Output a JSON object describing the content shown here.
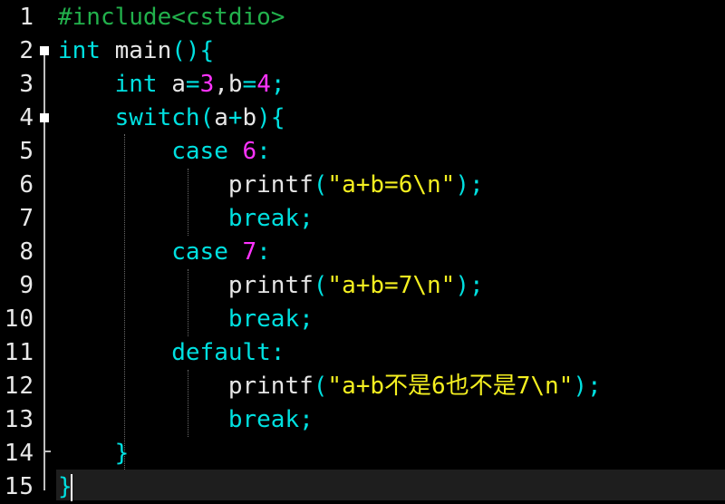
{
  "editor": {
    "colors": {
      "background": "#000000",
      "preprocessor": "#22b14c",
      "keyword": "#00e0e0",
      "identifier": "#e6e6e6",
      "number": "#ff33ff",
      "string": "#f5f020",
      "line_number": "#e8e8e8",
      "current_line": "#1e1e1e"
    },
    "line_numbers": [
      "1",
      "2",
      "3",
      "4",
      "5",
      "6",
      "7",
      "8",
      "9",
      "10",
      "11",
      "12",
      "13",
      "14",
      "15"
    ],
    "lines": [
      {
        "tokens": [
          {
            "t": "pre",
            "v": "#include<cstdio>"
          }
        ]
      },
      {
        "tokens": [
          {
            "t": "kw",
            "v": "int"
          },
          {
            "t": "id",
            "v": " main"
          },
          {
            "t": "kw",
            "v": "(){"
          }
        ]
      },
      {
        "tokens": [
          {
            "t": "id",
            "v": "    "
          },
          {
            "t": "kw",
            "v": "int"
          },
          {
            "t": "id",
            "v": " a"
          },
          {
            "t": "kw",
            "v": "="
          },
          {
            "t": "num",
            "v": "3"
          },
          {
            "t": "id",
            "v": ",b"
          },
          {
            "t": "kw",
            "v": "="
          },
          {
            "t": "num",
            "v": "4"
          },
          {
            "t": "kw",
            "v": ";"
          }
        ]
      },
      {
        "tokens": [
          {
            "t": "id",
            "v": "    "
          },
          {
            "t": "kw",
            "v": "switch("
          },
          {
            "t": "id",
            "v": "a"
          },
          {
            "t": "kw",
            "v": "+"
          },
          {
            "t": "id",
            "v": "b"
          },
          {
            "t": "kw",
            "v": "){"
          }
        ]
      },
      {
        "tokens": [
          {
            "t": "id",
            "v": "        "
          },
          {
            "t": "kw",
            "v": "case"
          },
          {
            "t": "id",
            "v": " "
          },
          {
            "t": "num",
            "v": "6"
          },
          {
            "t": "kw",
            "v": ":"
          }
        ]
      },
      {
        "tokens": [
          {
            "t": "id",
            "v": "            printf"
          },
          {
            "t": "kw",
            "v": "("
          },
          {
            "t": "str",
            "v": "\"a+b=6\\n\""
          },
          {
            "t": "kw",
            "v": ");"
          }
        ]
      },
      {
        "tokens": [
          {
            "t": "id",
            "v": "            "
          },
          {
            "t": "kw",
            "v": "break;"
          }
        ]
      },
      {
        "tokens": [
          {
            "t": "id",
            "v": "        "
          },
          {
            "t": "kw",
            "v": "case"
          },
          {
            "t": "id",
            "v": " "
          },
          {
            "t": "num",
            "v": "7"
          },
          {
            "t": "kw",
            "v": ":"
          }
        ]
      },
      {
        "tokens": [
          {
            "t": "id",
            "v": "            printf"
          },
          {
            "t": "kw",
            "v": "("
          },
          {
            "t": "str",
            "v": "\"a+b=7\\n\""
          },
          {
            "t": "kw",
            "v": ");"
          }
        ]
      },
      {
        "tokens": [
          {
            "t": "id",
            "v": "            "
          },
          {
            "t": "kw",
            "v": "break;"
          }
        ]
      },
      {
        "tokens": [
          {
            "t": "id",
            "v": "        "
          },
          {
            "t": "kw",
            "v": "default:"
          }
        ]
      },
      {
        "tokens": [
          {
            "t": "id",
            "v": "            printf"
          },
          {
            "t": "kw",
            "v": "("
          },
          {
            "t": "str",
            "v": "\"a+b不是6也不是7\\n\""
          },
          {
            "t": "kw",
            "v": ");"
          }
        ]
      },
      {
        "tokens": [
          {
            "t": "id",
            "v": "            "
          },
          {
            "t": "kw",
            "v": "break;"
          }
        ]
      },
      {
        "tokens": [
          {
            "t": "id",
            "v": "    "
          },
          {
            "t": "kw",
            "v": "}"
          }
        ]
      },
      {
        "tokens": [
          {
            "t": "kw",
            "v": "}"
          }
        ]
      }
    ]
  }
}
